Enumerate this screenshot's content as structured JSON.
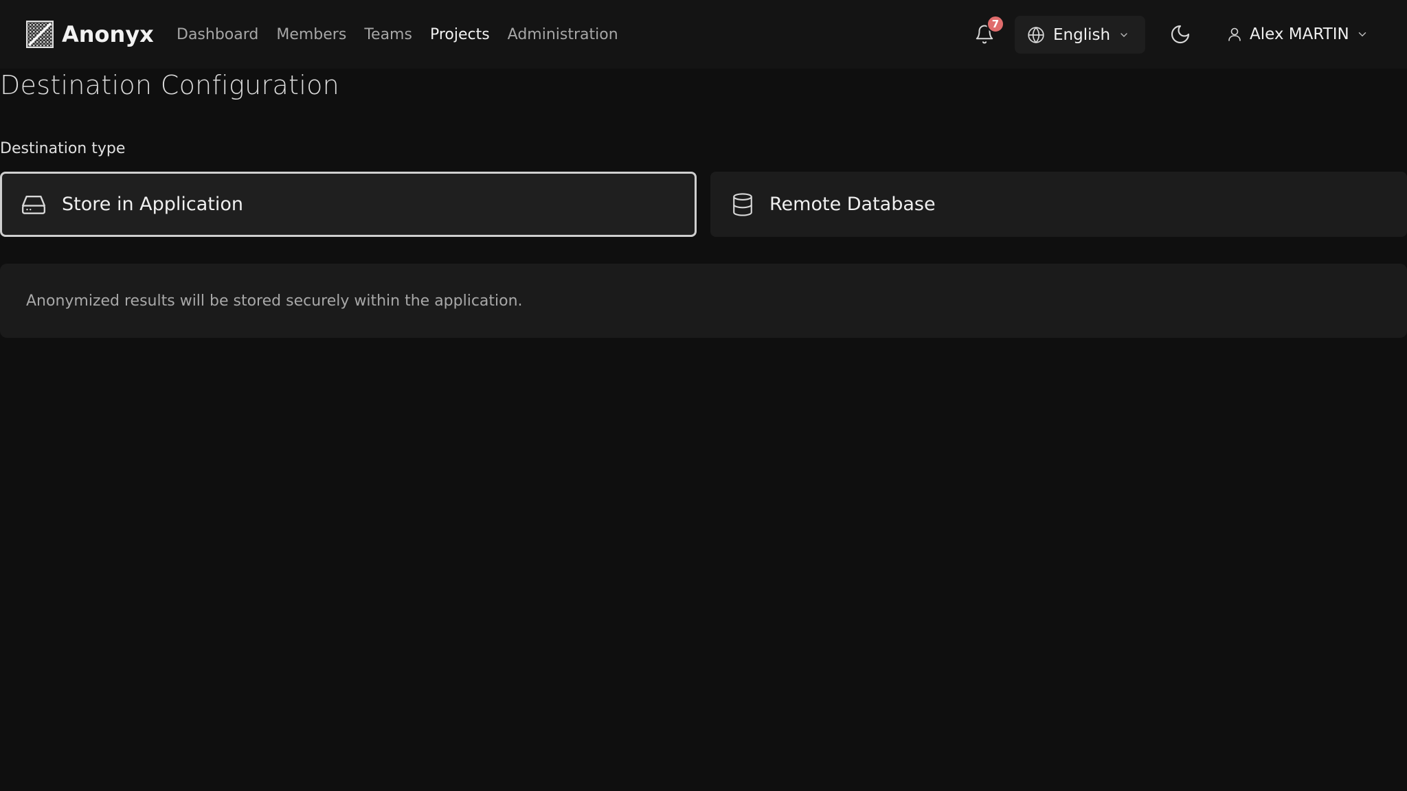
{
  "app": {
    "name": "Anonyx",
    "logo_icon": "app-logo-icon"
  },
  "nav": {
    "items": [
      {
        "label": "Dashboard",
        "active": false
      },
      {
        "label": "Members",
        "active": false
      },
      {
        "label": "Teams",
        "active": false
      },
      {
        "label": "Projects",
        "active": true
      },
      {
        "label": "Administration",
        "active": false
      }
    ]
  },
  "header": {
    "notifications": {
      "icon": "bell-icon",
      "count": "7"
    },
    "language": {
      "icon": "globe-icon",
      "label": "English"
    },
    "theme": {
      "icon": "moon-icon"
    },
    "user": {
      "icon": "user-icon",
      "name": "Alex MARTIN"
    }
  },
  "page": {
    "title": "Destination Configuration",
    "destination_type_label": "Destination type",
    "options": [
      {
        "label": "Store in Application",
        "icon": "hard-drive-icon",
        "selected": true
      },
      {
        "label": "Remote Database",
        "icon": "database-icon",
        "selected": false
      }
    ],
    "info": "Anonymized results will be stored securely within the application."
  },
  "colors": {
    "background": "#0f0f0f",
    "navbar": "#141414",
    "card": "#1c1c1c",
    "selected_border": "#cfcfcf",
    "badge": "#e06c6c"
  }
}
